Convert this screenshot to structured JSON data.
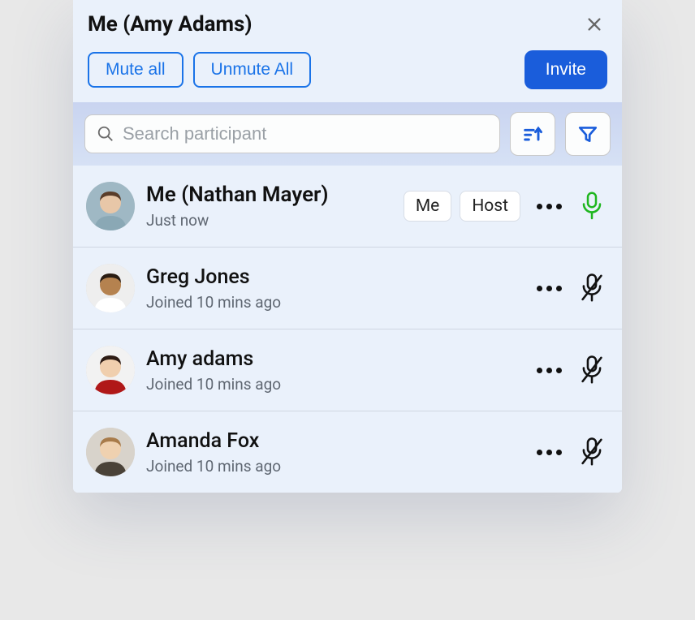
{
  "header": {
    "title": "Me (Amy Adams)",
    "mute_all": "Mute all",
    "unmute_all": "Unmute All",
    "invite": "Invite"
  },
  "search": {
    "placeholder": "Search participant"
  },
  "badges": {
    "me": "Me",
    "host": "Host"
  },
  "participants": [
    {
      "name": "Me (Nathan Mayer)",
      "sub": "Just now",
      "is_me": true,
      "is_host": true,
      "mic_on": true,
      "avatar_colors": {
        "bg": "#9fb8c4",
        "skin": "#e8c7a8",
        "shirt": "#8aa8b5",
        "hair": "#5a3d2a"
      }
    },
    {
      "name": "Greg Jones",
      "sub": "Joined 10 mins ago",
      "is_me": false,
      "is_host": false,
      "mic_on": false,
      "avatar_colors": {
        "bg": "#eeeeee",
        "skin": "#b5824f",
        "shirt": "#ffffff",
        "hair": "#2a1c12"
      }
    },
    {
      "name": "Amy adams",
      "sub": "Joined 10 mins ago",
      "is_me": false,
      "is_host": false,
      "mic_on": false,
      "avatar_colors": {
        "bg": "#f2f2f2",
        "skin": "#f0cfae",
        "shirt": "#b01818",
        "hair": "#2d1b14"
      }
    },
    {
      "name": "Amanda Fox",
      "sub": "Joined 10 mins ago",
      "is_me": false,
      "is_host": false,
      "mic_on": false,
      "avatar_colors": {
        "bg": "#d8d3cb",
        "skin": "#efd1b0",
        "shirt": "#4a4238",
        "hair": "#a87b4a"
      }
    }
  ]
}
